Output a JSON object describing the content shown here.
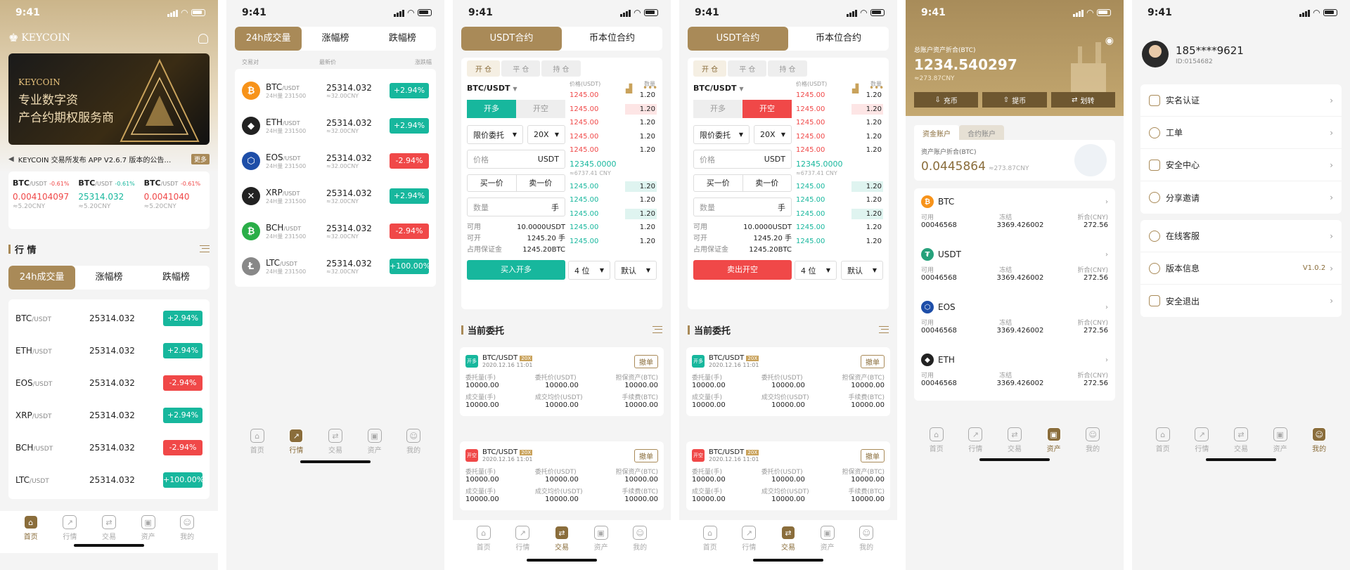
{
  "status_time": "9:41",
  "tabs": [
    "首页",
    "行情",
    "交易",
    "资产",
    "我的"
  ],
  "home": {
    "logo": "KEYCOIN",
    "banner_brand": "KEYCOIN",
    "banner_line1": "专业数字资",
    "banner_line2": "产合约期权服务商",
    "notice": "KEYCOIN 交易所发布 APP V2.6.7 版本的公告…",
    "notice_more": "更多",
    "tickers": [
      {
        "sym": "BTC",
        "quote": "/USDT",
        "chg": "-0.61%",
        "price": "0.004104097",
        "cny": "≈5.20CNY"
      },
      {
        "sym": "BTC",
        "quote": "/USDT",
        "chg": "-0.61%",
        "price": "25314.032",
        "cny": "≈5.20CNY"
      },
      {
        "sym": "BTC",
        "quote": "/USDT",
        "chg": "-0.61%",
        "price": "0.0041040",
        "cny": "≈5.20CNY"
      }
    ],
    "section": "行 情",
    "seg": [
      "24h成交量",
      "涨幅榜",
      "跌幅榜"
    ],
    "rows": [
      {
        "sym": "BTC",
        "quote": "/USDT",
        "price": "25314.032",
        "chg": "+2.94%",
        "dir": "up"
      },
      {
        "sym": "ETH",
        "quote": "/USDT",
        "price": "25314.032",
        "chg": "+2.94%",
        "dir": "up"
      },
      {
        "sym": "EOS",
        "quote": "/USDT",
        "price": "25314.032",
        "chg": "-2.94%",
        "dir": "down"
      },
      {
        "sym": "XRP",
        "quote": "/USDT",
        "price": "25314.032",
        "chg": "+2.94%",
        "dir": "up"
      },
      {
        "sym": "BCH",
        "quote": "/USDT",
        "price": "25314.032",
        "chg": "-2.94%",
        "dir": "down"
      },
      {
        "sym": "LTC",
        "quote": "/USDT",
        "price": "25314.032",
        "chg": "+100.00%",
        "dir": "up"
      }
    ]
  },
  "market": {
    "seg": [
      "24h成交量",
      "涨幅榜",
      "跌幅榜"
    ],
    "headers": [
      "交易对",
      "最新价",
      "涨跌幅"
    ],
    "rows": [
      {
        "sym": "BTC",
        "quote": "/USDT",
        "vol": "24H量 231500",
        "price": "25314.032",
        "cny": "≈32.00CNY",
        "chg": "+2.94%",
        "dir": "up",
        "color": "#f7931a",
        "glyph": "₿"
      },
      {
        "sym": "ETH",
        "quote": "/USDT",
        "vol": "24H量 231500",
        "price": "25314.032",
        "cny": "≈32.00CNY",
        "chg": "+2.94%",
        "dir": "up",
        "color": "#222222",
        "glyph": "◆"
      },
      {
        "sym": "EOS",
        "quote": "/USDT",
        "vol": "24H量 231500",
        "price": "25314.032",
        "cny": "≈32.00CNY",
        "chg": "-2.94%",
        "dir": "down",
        "color": "#1e4ea8",
        "glyph": "⬡"
      },
      {
        "sym": "XRP",
        "quote": "/USDT",
        "vol": "24H量 231500",
        "price": "25314.032",
        "cny": "≈32.00CNY",
        "chg": "+2.94%",
        "dir": "up",
        "color": "#222222",
        "glyph": "✕"
      },
      {
        "sym": "BCH",
        "quote": "/USDT",
        "vol": "24H量 231500",
        "price": "25314.032",
        "cny": "≈32.00CNY",
        "chg": "-2.94%",
        "dir": "down",
        "color": "#2aae48",
        "glyph": "₿"
      },
      {
        "sym": "LTC",
        "quote": "/USDT",
        "vol": "24H量 231500",
        "price": "25314.032",
        "cny": "≈32.00CNY",
        "chg": "+100.00%",
        "dir": "up",
        "color": "#888888",
        "glyph": "Ł"
      }
    ]
  },
  "trade": {
    "top_tabs": [
      "USDT合约",
      "币本位合约"
    ],
    "sub_tabs": [
      "开 仓",
      "平 仓",
      "持 仓"
    ],
    "pair": "BTC/USDT",
    "long": "开多",
    "short": "开空",
    "order_type": "限价委托",
    "leverage": "20X",
    "price_ph": "价格",
    "price_unit": "USDT",
    "buy1": "买一价",
    "sell1": "卖一价",
    "qty_ph": "数量",
    "qty_unit": "手",
    "avail_l": "可用",
    "avail_v": "10.0000USDT",
    "open_l": "可开",
    "open_v": "1245.20 手",
    "margin_l": "占用保证金",
    "margin_v": "1245.20BTC",
    "buy_btn": "买入开多",
    "sell_btn": "卖出开空",
    "depth": "4 位",
    "default": "默认",
    "ob_h1": "价格(USDT)",
    "ob_h2": "数量",
    "asks": [
      "1245.00",
      "1245.00",
      "1245.00",
      "1245.00",
      "1245.00"
    ],
    "bids": [
      "1245.00",
      "1245.00",
      "1245.00",
      "1245.00",
      "1245.00"
    ],
    "qty": "1.20",
    "mid": "12345.0000",
    "mid_cny": "≈6737.41 CNY",
    "section": "当前委托",
    "orders": [
      {
        "badge": "开多",
        "pair": "BTC/USDT",
        "lev": "20X",
        "date": "2020.12.16 11:01",
        "btn": "撤单",
        "l1": [
          "委托量(手)",
          "委托价(USDT)",
          "担保资产(BTC)"
        ],
        "v1": [
          "10000.00",
          "10000.00",
          "10000.00"
        ],
        "l2": [
          "成交量(手)",
          "成交均价(USDT)",
          "手续费(BTC)"
        ],
        "v2": [
          "10000.00",
          "10000.00",
          "10000.00"
        ]
      },
      {
        "badge": "开空",
        "pair": "BTC/USDT",
        "lev": "20X",
        "date": "2020.12.16 11:01",
        "btn": "撤单",
        "l1": [
          "委托量(手)",
          "委托价(USDT)",
          "担保资产(BTC)"
        ],
        "v1": [
          "10000.00",
          "10000.00",
          "10000.00"
        ],
        "l2": [
          "成交量(手)",
          "成交均价(USDT)",
          "手续费(BTC)"
        ],
        "v2": [
          "10000.00",
          "10000.00",
          "10000.00"
        ]
      }
    ]
  },
  "assets": {
    "label": "总账户资产折合(BTC)",
    "total": "1234.540297",
    "cny": "≈273.87CNY",
    "actions": [
      "充币",
      "提币",
      "划转"
    ],
    "tabs": [
      "资金账户",
      "合约账户"
    ],
    "acc_label": "资产账户折合(BTC)",
    "acc_val": "0.0445864",
    "acc_cny": "≈273.87CNY",
    "cols": [
      "可用",
      "冻结",
      "折合(CNY)"
    ],
    "coins": [
      {
        "sym": "BTC",
        "avail": "00046568",
        "frozen": "3369.426002",
        "cny": "272.56",
        "color": "#f7931a",
        "glyph": "₿"
      },
      {
        "sym": "USDT",
        "avail": "00046568",
        "frozen": "3369.426002",
        "cny": "272.56",
        "color": "#26a17b",
        "glyph": "₮"
      },
      {
        "sym": "EOS",
        "avail": "00046568",
        "frozen": "3369.426002",
        "cny": "272.56",
        "color": "#1e4ea8",
        "glyph": "⬡"
      },
      {
        "sym": "ETH",
        "avail": "00046568",
        "frozen": "3369.426002",
        "cny": "272.56",
        "color": "#222222",
        "glyph": "◆"
      }
    ]
  },
  "me": {
    "phone": "185****9621",
    "uid": "ID:0154682",
    "group1": [
      "实名认证",
      "工单",
      "安全中心",
      "分享邀请"
    ],
    "group2": [
      "在线客服",
      "版本信息",
      "安全退出"
    ],
    "version": "V1.0.2"
  }
}
